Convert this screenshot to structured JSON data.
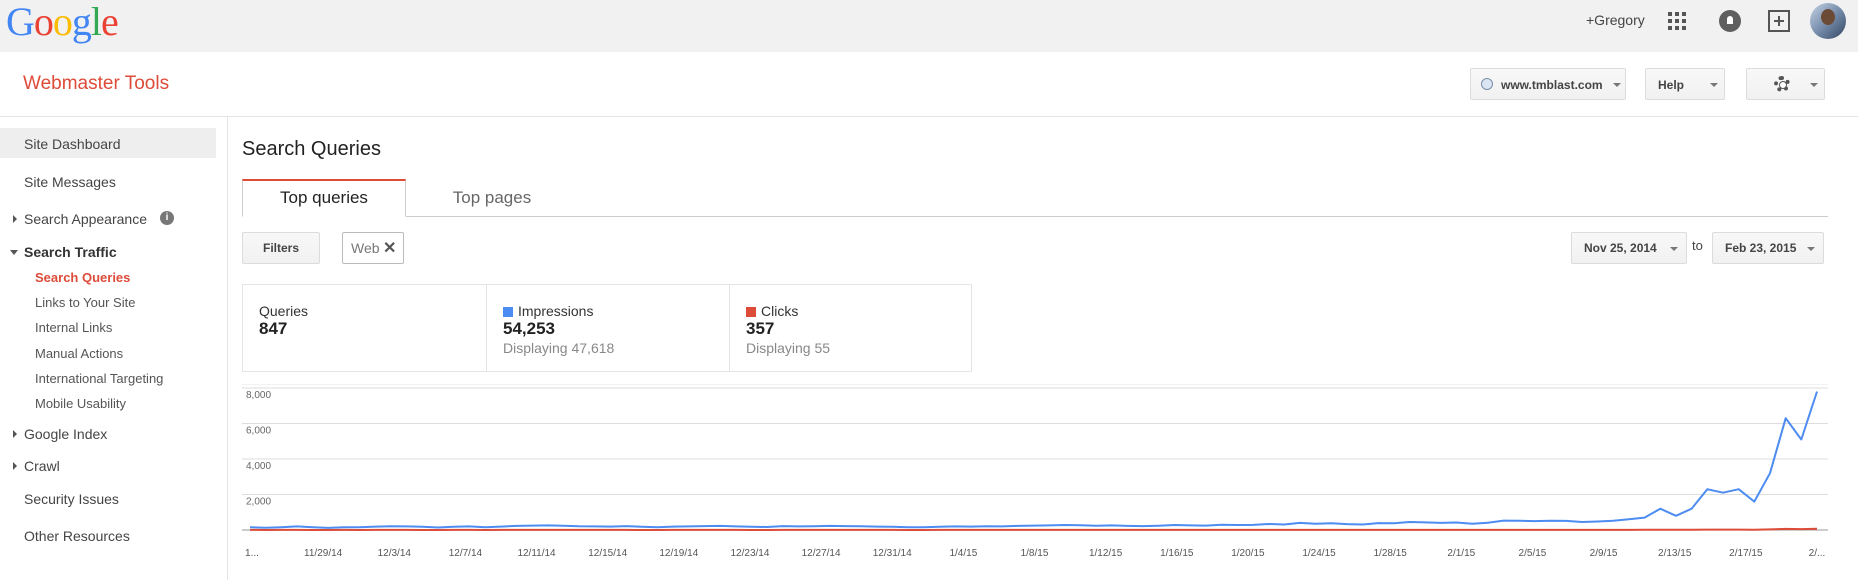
{
  "google_bar": {
    "logo_letters": [
      {
        "t": "G",
        "c": "#4285f4"
      },
      {
        "t": "o",
        "c": "#ea4335"
      },
      {
        "t": "o",
        "c": "#fbbc05"
      },
      {
        "t": "g",
        "c": "#4285f4"
      },
      {
        "t": "l",
        "c": "#34a853"
      },
      {
        "t": "e",
        "c": "#ea4335"
      }
    ],
    "user": "+Gregory",
    "icons": [
      "apps-grid-icon",
      "notifications-icon",
      "share-plus-icon",
      "avatar"
    ]
  },
  "header": {
    "product_title": "Webmaster Tools",
    "site_selector": "www.tmblast.com",
    "help_label": "Help",
    "settings_icon": "gear-icon"
  },
  "sidebar": {
    "site_dashboard": "Site Dashboard",
    "site_messages": "Site Messages",
    "search_appearance": "Search Appearance",
    "search_traffic": "Search Traffic",
    "search_traffic_items": [
      "Search Queries",
      "Links to Your Site",
      "Internal Links",
      "Manual Actions",
      "International Targeting",
      "Mobile Usability"
    ],
    "google_index": "Google Index",
    "crawl": "Crawl",
    "security_issues": "Security Issues",
    "other_resources": "Other Resources"
  },
  "main": {
    "title": "Search Queries",
    "tabs": [
      "Top queries",
      "Top pages"
    ],
    "filters_label": "Filters",
    "filter_chip": "Web",
    "date_from": "Nov 25, 2014",
    "date_to_word": "to",
    "date_to": "Feb 23, 2015"
  },
  "stats": {
    "queries_label": "Queries",
    "queries_value": "847",
    "impressions_label": "Impressions",
    "impressions_value": "54,253",
    "impressions_display": "Displaying 47,618",
    "clicks_label": "Clicks",
    "clicks_value": "357",
    "clicks_display": "Displaying 55"
  },
  "colors": {
    "accent_red": "#dd4b39",
    "impressions": "#4d8cf0",
    "clicks": "#dd4b39"
  },
  "chart_data": {
    "type": "line",
    "ylim": [
      0,
      8000
    ],
    "y_ticks": [
      "8,000",
      "6,000",
      "4,000",
      "2,000"
    ],
    "x_tick_labels": [
      "1...",
      "11/29/14",
      "12/3/14",
      "12/7/14",
      "12/11/14",
      "12/15/14",
      "12/19/14",
      "12/23/14",
      "12/27/14",
      "12/31/14",
      "1/4/15",
      "1/8/15",
      "1/12/15",
      "1/16/15",
      "1/20/15",
      "1/24/15",
      "1/28/15",
      "2/1/15",
      "2/5/15",
      "2/9/15",
      "2/13/15",
      "2/17/15",
      "2/..."
    ],
    "series": [
      {
        "name": "Impressions",
        "color": "#4d8cf0",
        "values": [
          150,
          130,
          160,
          200,
          160,
          120,
          150,
          160,
          190,
          210,
          200,
          180,
          140,
          180,
          200,
          150,
          190,
          230,
          250,
          260,
          240,
          210,
          200,
          190,
          220,
          180,
          160,
          190,
          200,
          220,
          230,
          200,
          180,
          170,
          220,
          200,
          210,
          230,
          220,
          210,
          190,
          180,
          150,
          160,
          180,
          200,
          190,
          210,
          200,
          230,
          250,
          260,
          280,
          270,
          240,
          260,
          230,
          220,
          240,
          280,
          260,
          250,
          300,
          280,
          290,
          340,
          310,
          400,
          350,
          380,
          330,
          310,
          390,
          380,
          450,
          430,
          400,
          420,
          350,
          410,
          530,
          520,
          500,
          520,
          510,
          450,
          480,
          520,
          600,
          700,
          1200,
          800,
          1200,
          2300,
          2100,
          2300,
          1600,
          3200,
          6300,
          5100,
          7800
        ]
      },
      {
        "name": "Clicks",
        "color": "#dd4b39",
        "values": [
          3,
          2,
          3,
          3,
          2,
          2,
          3,
          2,
          3,
          3,
          3,
          2,
          2,
          3,
          3,
          2,
          3,
          3,
          4,
          4,
          3,
          3,
          3,
          3,
          3,
          2,
          2,
          3,
          3,
          3,
          3,
          3,
          2,
          2,
          3,
          3,
          3,
          3,
          3,
          3,
          3,
          3,
          2,
          2,
          3,
          3,
          3,
          3,
          3,
          3,
          4,
          4,
          4,
          4,
          3,
          4,
          3,
          3,
          3,
          4,
          4,
          4,
          4,
          4,
          4,
          5,
          4,
          5,
          5,
          5,
          5,
          4,
          5,
          5,
          6,
          6,
          5,
          6,
          5,
          6,
          7,
          7,
          7,
          7,
          7,
          6,
          6,
          7,
          8,
          9,
          15,
          10,
          15,
          25,
          22,
          25,
          18,
          35,
          60,
          50,
          75
        ]
      }
    ]
  }
}
